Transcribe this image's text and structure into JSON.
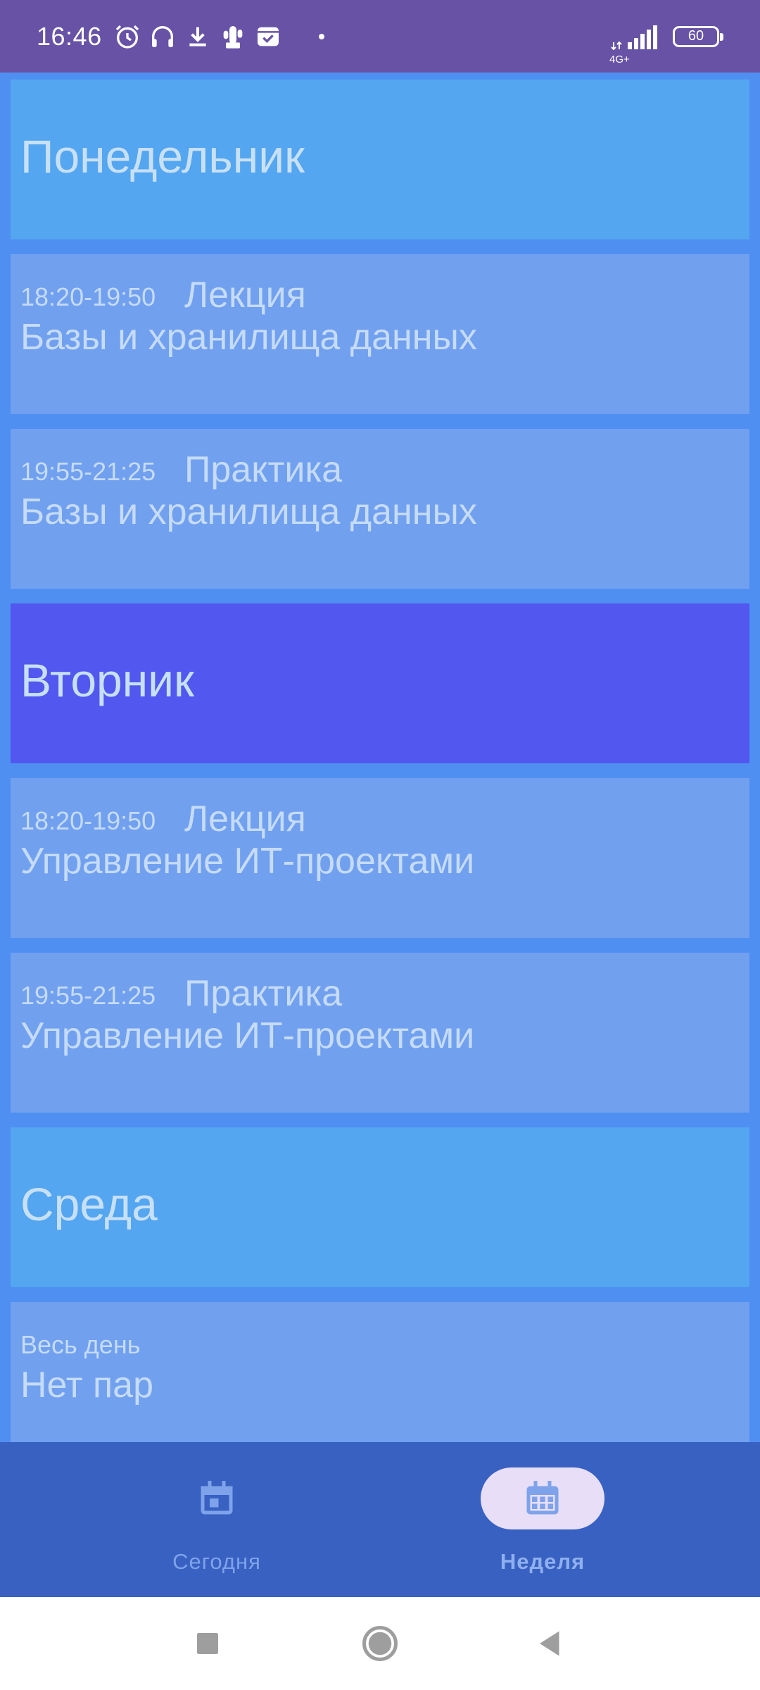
{
  "status_bar": {
    "time": "16:46",
    "network": "4G+",
    "battery": "60",
    "icons": [
      "alarm-icon",
      "headphones-icon",
      "download-icon",
      "cactus-icon",
      "mail-check-icon",
      "signal-icon",
      "battery-icon"
    ]
  },
  "schedule": [
    {
      "type": "day",
      "title": "Понедельник",
      "selected": false
    },
    {
      "type": "class",
      "time": "18:20-19:50",
      "kind": "Лекция",
      "subject": "Базы и хранилища данных"
    },
    {
      "type": "class",
      "time": "19:55-21:25",
      "kind": "Практика",
      "subject": "Базы и хранилища данных"
    },
    {
      "type": "day",
      "title": "Вторник",
      "selected": true
    },
    {
      "type": "class",
      "time": "18:20-19:50",
      "kind": "Лекция",
      "subject": "Управление ИТ-проектами"
    },
    {
      "type": "class",
      "time": "19:55-21:25",
      "kind": "Практика",
      "subject": "Управление ИТ-проектами"
    },
    {
      "type": "day",
      "title": "Среда",
      "selected": false
    },
    {
      "type": "class",
      "time": "Весь день",
      "kind": "",
      "subject": "Нет пар"
    }
  ],
  "bottom_nav": {
    "today_label": "Сегодня",
    "week_label": "Неделя",
    "active": "week"
  },
  "colors": {
    "status_bar": "#6752a6",
    "background": "#508ff2",
    "day_card": "#53a6ef",
    "day_card_selected": "#5257ef",
    "class_card": "#71a0ef",
    "bottom_nav": "#3861c1",
    "active_pill": "#e8def8"
  }
}
